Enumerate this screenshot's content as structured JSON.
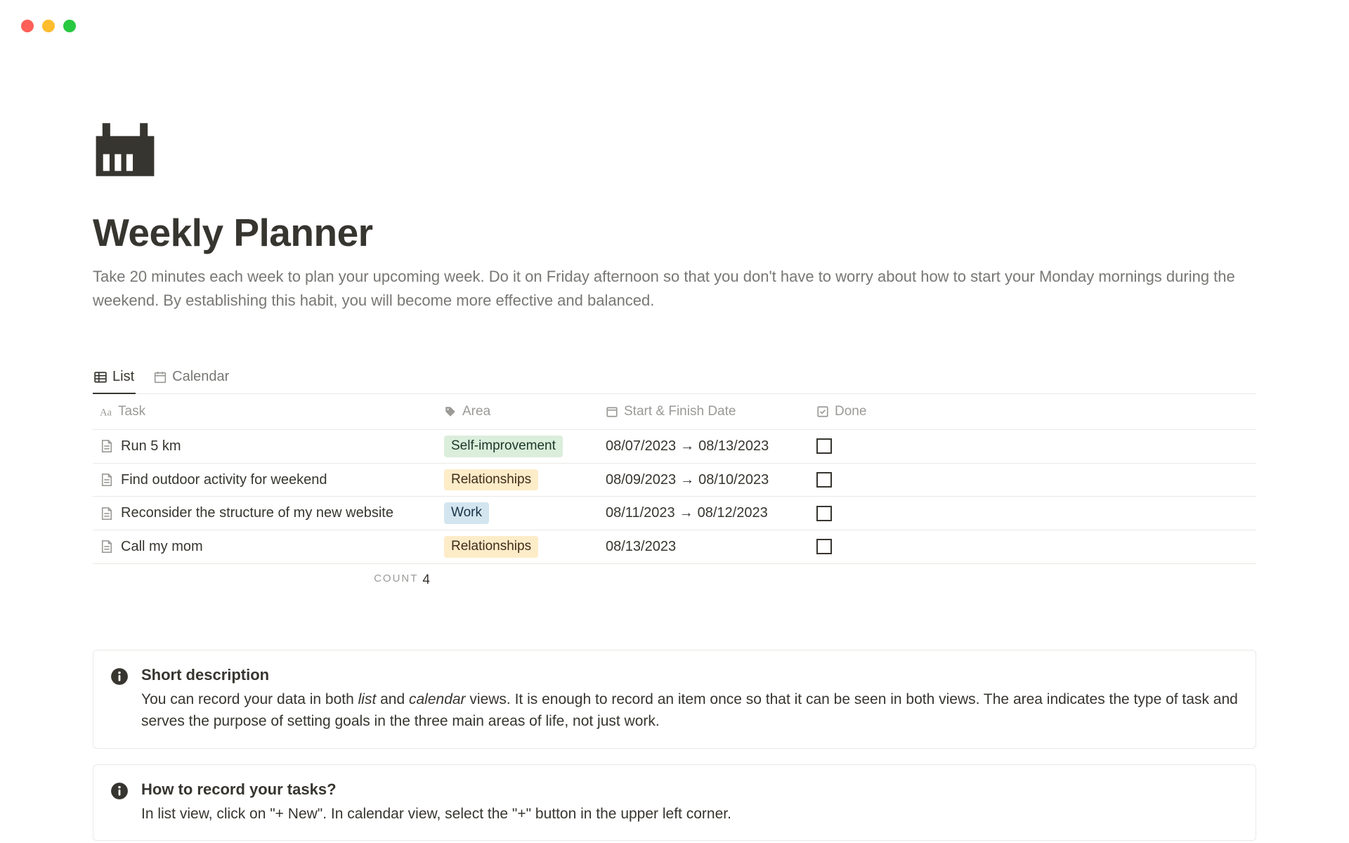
{
  "header": {
    "title": "Weekly Planner",
    "subtitle": "Take 20 minutes each week to plan your upcoming week. Do it on Friday afternoon so that you don't have to worry about how to start your Monday mornings during the weekend. By establishing this habit, you will become more effective and balanced."
  },
  "tabs": {
    "list": "List",
    "calendar": "Calendar"
  },
  "columns": {
    "task": "Task",
    "area": "Area",
    "date": "Start & Finish Date",
    "done": "Done"
  },
  "rows": [
    {
      "task": "Run 5 km",
      "area": "Self-improvement",
      "area_class": "tag-self",
      "start": "08/07/2023",
      "end": "08/13/2023"
    },
    {
      "task": "Find outdoor activity for weekend",
      "area": "Relationships",
      "area_class": "tag-rel",
      "start": "08/09/2023",
      "end": "08/10/2023"
    },
    {
      "task": "Reconsider the structure of my new website",
      "area": "Work",
      "area_class": "tag-work",
      "start": "08/11/2023",
      "end": "08/12/2023"
    },
    {
      "task": "Call my mom",
      "area": "Relationships",
      "area_class": "tag-rel",
      "start": "08/13/2023",
      "end": ""
    }
  ],
  "count": {
    "label": "COUNT",
    "value": "4"
  },
  "callouts": [
    {
      "title": "Short description",
      "html": "You can record your data in both <em>list</em> and <em>calendar</em> views. It is enough to record an item once so that it can be seen in both views. The area indicates the type of task and serves the purpose of setting goals in the three main areas of life, not just work."
    },
    {
      "title": "How to record your tasks?",
      "html": "In list view, click on \"+ New\". In calendar view, select the \"+\" button in the upper left corner."
    }
  ]
}
